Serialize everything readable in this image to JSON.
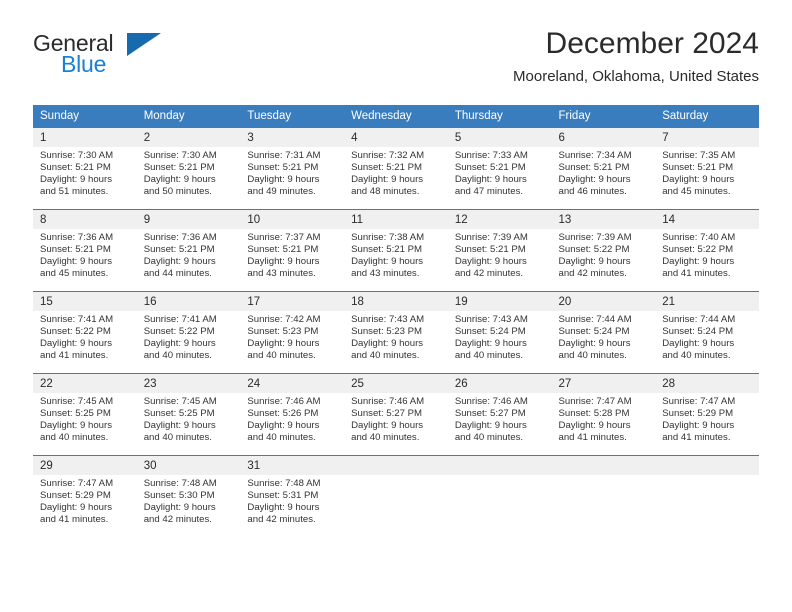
{
  "brand": {
    "name_top": "General",
    "name_bottom": "Blue",
    "triangle_icon": "triangle-icon",
    "colors": {
      "blue": "#1b7fd4",
      "triangle": "#166aad",
      "dark": "#2b2b2b"
    }
  },
  "header": {
    "month_title": "December 2024",
    "location": "Mooreland, Oklahoma, United States"
  },
  "theme": {
    "header_bg": "#3a7dbf",
    "header_text": "#ffffff",
    "daynum_bg": "#f0f0f0",
    "rule": "#3a7dbf"
  },
  "calendar": {
    "weekday_headers": [
      "Sunday",
      "Monday",
      "Tuesday",
      "Wednesday",
      "Thursday",
      "Friday",
      "Saturday"
    ],
    "weeks": [
      {
        "days": [
          {
            "num": "1",
            "sunrise": "Sunrise: 7:30 AM",
            "sunset": "Sunset: 5:21 PM",
            "daylight_1": "Daylight: 9 hours",
            "daylight_2": "and 51 minutes."
          },
          {
            "num": "2",
            "sunrise": "Sunrise: 7:30 AM",
            "sunset": "Sunset: 5:21 PM",
            "daylight_1": "Daylight: 9 hours",
            "daylight_2": "and 50 minutes."
          },
          {
            "num": "3",
            "sunrise": "Sunrise: 7:31 AM",
            "sunset": "Sunset: 5:21 PM",
            "daylight_1": "Daylight: 9 hours",
            "daylight_2": "and 49 minutes."
          },
          {
            "num": "4",
            "sunrise": "Sunrise: 7:32 AM",
            "sunset": "Sunset: 5:21 PM",
            "daylight_1": "Daylight: 9 hours",
            "daylight_2": "and 48 minutes."
          },
          {
            "num": "5",
            "sunrise": "Sunrise: 7:33 AM",
            "sunset": "Sunset: 5:21 PM",
            "daylight_1": "Daylight: 9 hours",
            "daylight_2": "and 47 minutes."
          },
          {
            "num": "6",
            "sunrise": "Sunrise: 7:34 AM",
            "sunset": "Sunset: 5:21 PM",
            "daylight_1": "Daylight: 9 hours",
            "daylight_2": "and 46 minutes."
          },
          {
            "num": "7",
            "sunrise": "Sunrise: 7:35 AM",
            "sunset": "Sunset: 5:21 PM",
            "daylight_1": "Daylight: 9 hours",
            "daylight_2": "and 45 minutes."
          }
        ]
      },
      {
        "days": [
          {
            "num": "8",
            "sunrise": "Sunrise: 7:36 AM",
            "sunset": "Sunset: 5:21 PM",
            "daylight_1": "Daylight: 9 hours",
            "daylight_2": "and 45 minutes."
          },
          {
            "num": "9",
            "sunrise": "Sunrise: 7:36 AM",
            "sunset": "Sunset: 5:21 PM",
            "daylight_1": "Daylight: 9 hours",
            "daylight_2": "and 44 minutes."
          },
          {
            "num": "10",
            "sunrise": "Sunrise: 7:37 AM",
            "sunset": "Sunset: 5:21 PM",
            "daylight_1": "Daylight: 9 hours",
            "daylight_2": "and 43 minutes."
          },
          {
            "num": "11",
            "sunrise": "Sunrise: 7:38 AM",
            "sunset": "Sunset: 5:21 PM",
            "daylight_1": "Daylight: 9 hours",
            "daylight_2": "and 43 minutes."
          },
          {
            "num": "12",
            "sunrise": "Sunrise: 7:39 AM",
            "sunset": "Sunset: 5:21 PM",
            "daylight_1": "Daylight: 9 hours",
            "daylight_2": "and 42 minutes."
          },
          {
            "num": "13",
            "sunrise": "Sunrise: 7:39 AM",
            "sunset": "Sunset: 5:22 PM",
            "daylight_1": "Daylight: 9 hours",
            "daylight_2": "and 42 minutes."
          },
          {
            "num": "14",
            "sunrise": "Sunrise: 7:40 AM",
            "sunset": "Sunset: 5:22 PM",
            "daylight_1": "Daylight: 9 hours",
            "daylight_2": "and 41 minutes."
          }
        ]
      },
      {
        "days": [
          {
            "num": "15",
            "sunrise": "Sunrise: 7:41 AM",
            "sunset": "Sunset: 5:22 PM",
            "daylight_1": "Daylight: 9 hours",
            "daylight_2": "and 41 minutes."
          },
          {
            "num": "16",
            "sunrise": "Sunrise: 7:41 AM",
            "sunset": "Sunset: 5:22 PM",
            "daylight_1": "Daylight: 9 hours",
            "daylight_2": "and 40 minutes."
          },
          {
            "num": "17",
            "sunrise": "Sunrise: 7:42 AM",
            "sunset": "Sunset: 5:23 PM",
            "daylight_1": "Daylight: 9 hours",
            "daylight_2": "and 40 minutes."
          },
          {
            "num": "18",
            "sunrise": "Sunrise: 7:43 AM",
            "sunset": "Sunset: 5:23 PM",
            "daylight_1": "Daylight: 9 hours",
            "daylight_2": "and 40 minutes."
          },
          {
            "num": "19",
            "sunrise": "Sunrise: 7:43 AM",
            "sunset": "Sunset: 5:24 PM",
            "daylight_1": "Daylight: 9 hours",
            "daylight_2": "and 40 minutes."
          },
          {
            "num": "20",
            "sunrise": "Sunrise: 7:44 AM",
            "sunset": "Sunset: 5:24 PM",
            "daylight_1": "Daylight: 9 hours",
            "daylight_2": "and 40 minutes."
          },
          {
            "num": "21",
            "sunrise": "Sunrise: 7:44 AM",
            "sunset": "Sunset: 5:24 PM",
            "daylight_1": "Daylight: 9 hours",
            "daylight_2": "and 40 minutes."
          }
        ]
      },
      {
        "days": [
          {
            "num": "22",
            "sunrise": "Sunrise: 7:45 AM",
            "sunset": "Sunset: 5:25 PM",
            "daylight_1": "Daylight: 9 hours",
            "daylight_2": "and 40 minutes."
          },
          {
            "num": "23",
            "sunrise": "Sunrise: 7:45 AM",
            "sunset": "Sunset: 5:25 PM",
            "daylight_1": "Daylight: 9 hours",
            "daylight_2": "and 40 minutes."
          },
          {
            "num": "24",
            "sunrise": "Sunrise: 7:46 AM",
            "sunset": "Sunset: 5:26 PM",
            "daylight_1": "Daylight: 9 hours",
            "daylight_2": "and 40 minutes."
          },
          {
            "num": "25",
            "sunrise": "Sunrise: 7:46 AM",
            "sunset": "Sunset: 5:27 PM",
            "daylight_1": "Daylight: 9 hours",
            "daylight_2": "and 40 minutes."
          },
          {
            "num": "26",
            "sunrise": "Sunrise: 7:46 AM",
            "sunset": "Sunset: 5:27 PM",
            "daylight_1": "Daylight: 9 hours",
            "daylight_2": "and 40 minutes."
          },
          {
            "num": "27",
            "sunrise": "Sunrise: 7:47 AM",
            "sunset": "Sunset: 5:28 PM",
            "daylight_1": "Daylight: 9 hours",
            "daylight_2": "and 41 minutes."
          },
          {
            "num": "28",
            "sunrise": "Sunrise: 7:47 AM",
            "sunset": "Sunset: 5:29 PM",
            "daylight_1": "Daylight: 9 hours",
            "daylight_2": "and 41 minutes."
          }
        ]
      },
      {
        "days": [
          {
            "num": "29",
            "sunrise": "Sunrise: 7:47 AM",
            "sunset": "Sunset: 5:29 PM",
            "daylight_1": "Daylight: 9 hours",
            "daylight_2": "and 41 minutes."
          },
          {
            "num": "30",
            "sunrise": "Sunrise: 7:48 AM",
            "sunset": "Sunset: 5:30 PM",
            "daylight_1": "Daylight: 9 hours",
            "daylight_2": "and 42 minutes."
          },
          {
            "num": "31",
            "sunrise": "Sunrise: 7:48 AM",
            "sunset": "Sunset: 5:31 PM",
            "daylight_1": "Daylight: 9 hours",
            "daylight_2": "and 42 minutes."
          },
          {
            "num": "",
            "sunrise": "",
            "sunset": "",
            "daylight_1": "",
            "daylight_2": ""
          },
          {
            "num": "",
            "sunrise": "",
            "sunset": "",
            "daylight_1": "",
            "daylight_2": ""
          },
          {
            "num": "",
            "sunrise": "",
            "sunset": "",
            "daylight_1": "",
            "daylight_2": ""
          },
          {
            "num": "",
            "sunrise": "",
            "sunset": "",
            "daylight_1": "",
            "daylight_2": ""
          }
        ]
      }
    ]
  }
}
